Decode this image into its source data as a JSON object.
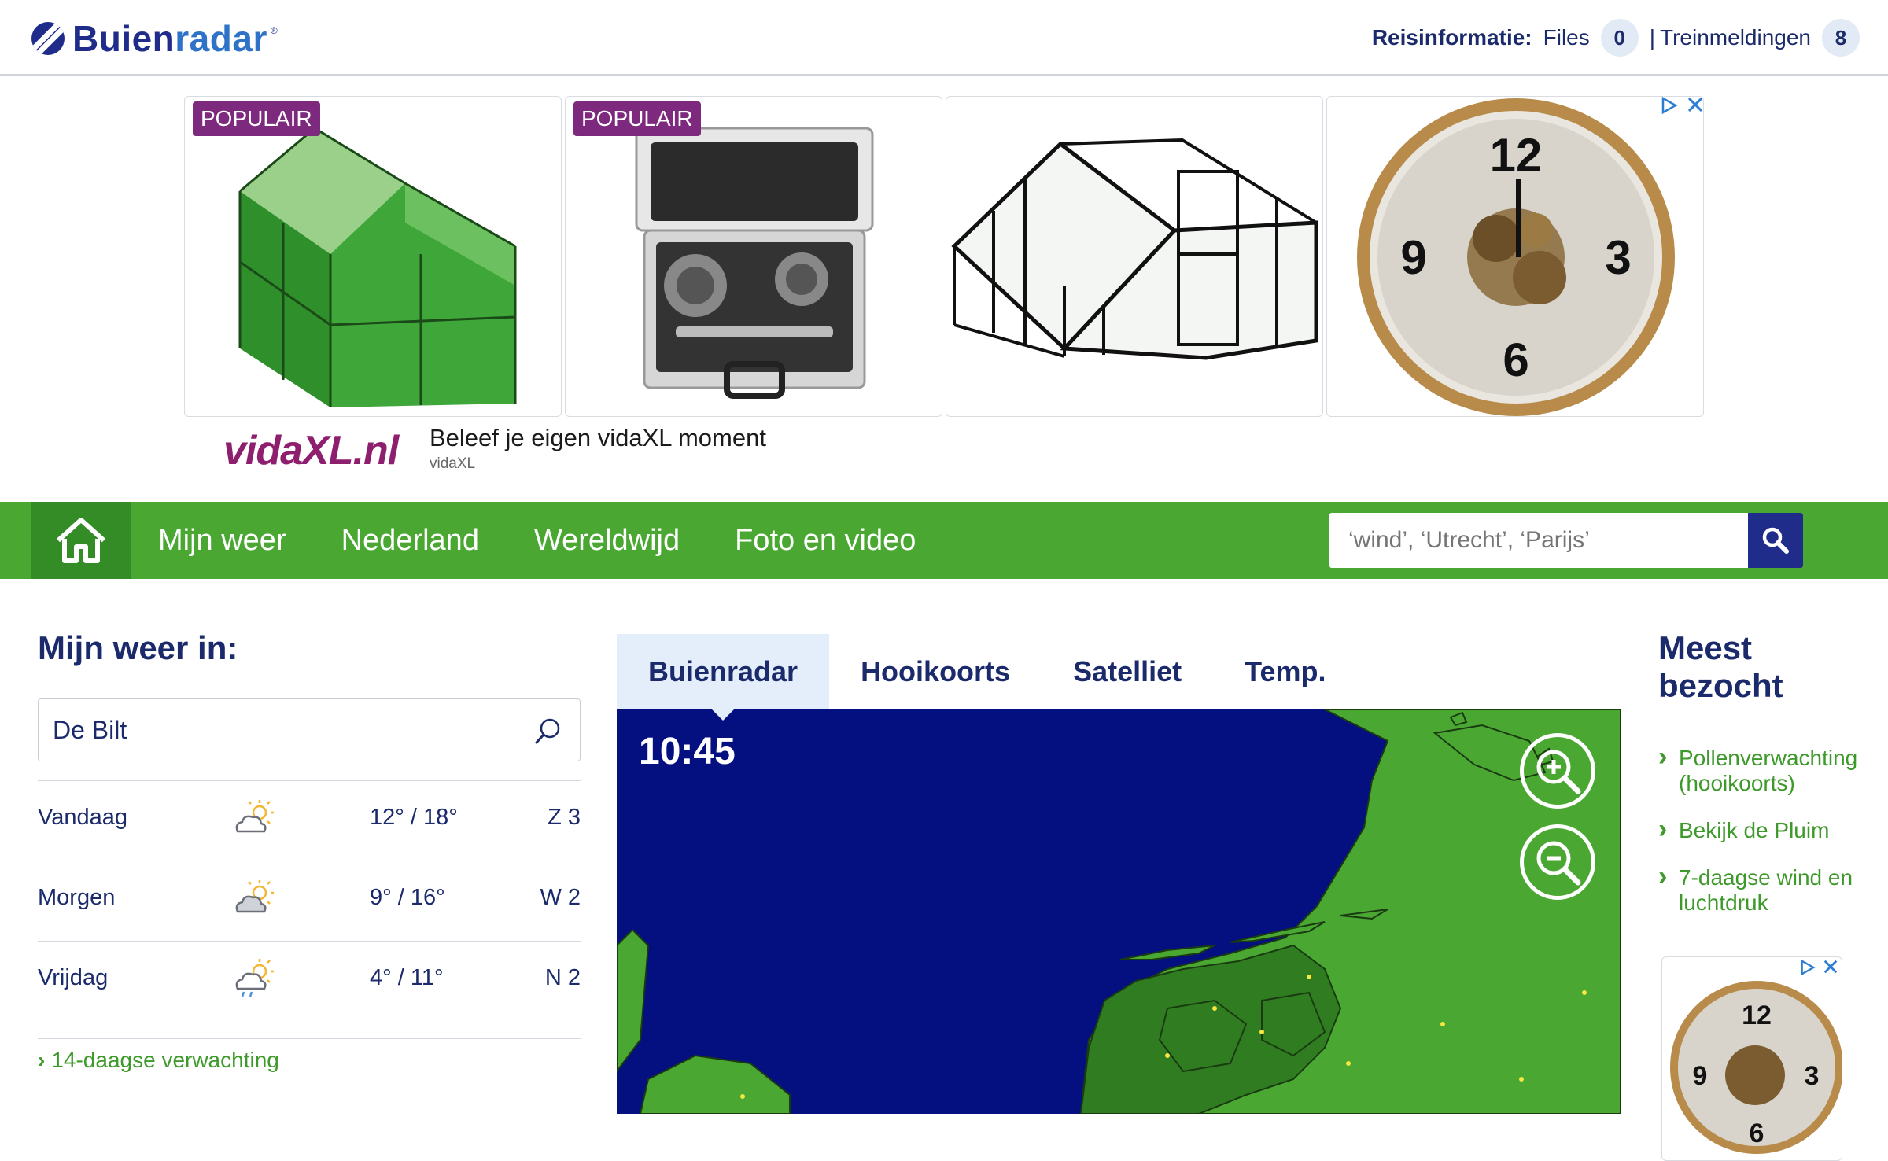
{
  "header": {
    "logo": {
      "part1": "Buien",
      "part2": "radar",
      "reg": "®"
    },
    "reis_label": "Reisinformatie:",
    "files_label": "Files",
    "files_count": "0",
    "separator": "|",
    "trein_label": "Treinmeldingen",
    "trein_count": "8"
  },
  "ad": {
    "badges": [
      "POPULAIR",
      "POPULAIR"
    ],
    "choice_icon": "adchoices-icon",
    "close_icon": "close-icon",
    "brand": "vidaXL.nl",
    "title": "Beleef je eigen vidaXL moment",
    "subtitle": "vidaXL",
    "clock_numbers": [
      "12",
      "3",
      "6",
      "9"
    ]
  },
  "nav": {
    "items": [
      "Mijn weer",
      "Nederland",
      "Wereldwijd",
      "Foto en video"
    ],
    "search_placeholder": "‘wind’, ‘Utrecht’, ‘Parijs’"
  },
  "mijn_weer": {
    "title": "Mijn weer in:",
    "location": "De Bilt",
    "forecast": [
      {
        "day": "Vandaag",
        "icon": "partly-cloudy-sun-icon",
        "temp": "12° / 18°",
        "wind": "Z 3"
      },
      {
        "day": "Morgen",
        "icon": "partly-cloudy-sun-icon",
        "temp": "9° / 16°",
        "wind": "W 2"
      },
      {
        "day": "Vrijdag",
        "icon": "cloud-rain-sun-icon",
        "temp": "4° / 11°",
        "wind": "N 2"
      }
    ],
    "more_link": "14-daagse verwachting"
  },
  "radar": {
    "tabs": [
      "Buienradar",
      "Hooikoorts",
      "Satelliet",
      "Temp."
    ],
    "active_tab": "Buienradar",
    "time": "10:45",
    "colors": {
      "sea": "#051080",
      "land": "#4aa832",
      "land_dark": "#2f7d20"
    }
  },
  "meest_bezocht": {
    "title": "Meest bezocht",
    "links": [
      "Pollenverwachting (hooikoorts)",
      "Bekijk de Pluim",
      "7-daagse wind en luchtdruk"
    ]
  },
  "colors": {
    "brand_blue": "#1b2a6b",
    "green": "#4aa832",
    "link_green": "#3d9a2a",
    "popular_purple": "#7d2a7e"
  }
}
